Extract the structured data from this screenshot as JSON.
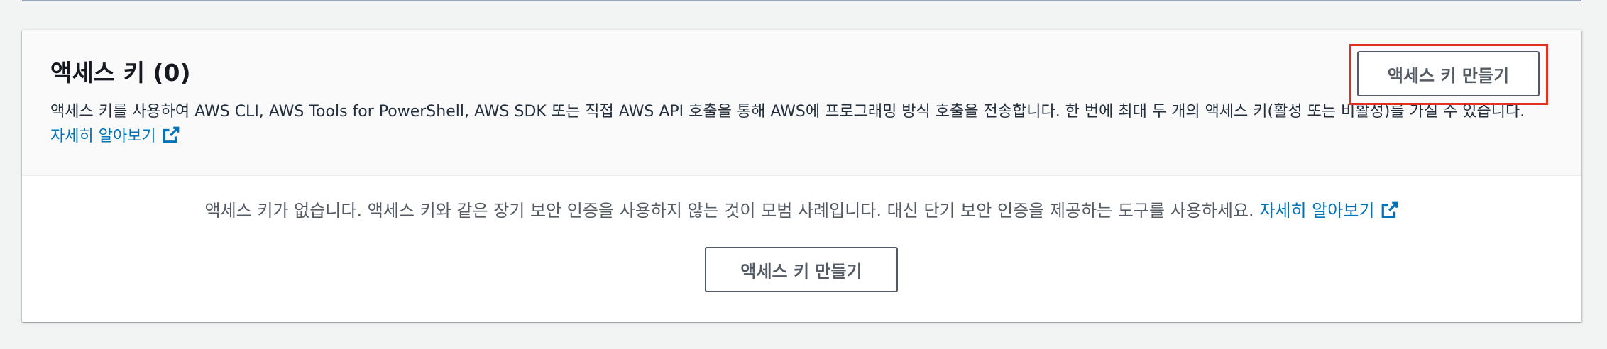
{
  "section": {
    "title": "액세스 키 (0)",
    "description": "액세스 키를 사용하여 AWS CLI, AWS Tools for PowerShell, AWS SDK 또는 직접 AWS API 호출을 통해 AWS에 프로그래밍 방식 호출을 전송합니다. 한 번에 최대 두 개의 액세스 키(활성 또는 비활성)를 가질 수 있습니다.",
    "learn_more": "자세히 알아보기",
    "create_button": "액세스 키 만들기"
  },
  "empty_state": {
    "message": "액세스 키가 없습니다. 액세스 키와 같은 장기 보안 인증을 사용하지 않는 것이 모범 사례입니다. 대신 단기 보안 인증을 제공하는 도구를 사용하세요.",
    "learn_more": "자세히 알아보기",
    "create_button": "액세스 키 만들기"
  },
  "colors": {
    "link": "#0073bb",
    "highlight": "#e0301e",
    "button_border": "#545b64"
  },
  "icons": [
    "external-link-icon"
  ]
}
